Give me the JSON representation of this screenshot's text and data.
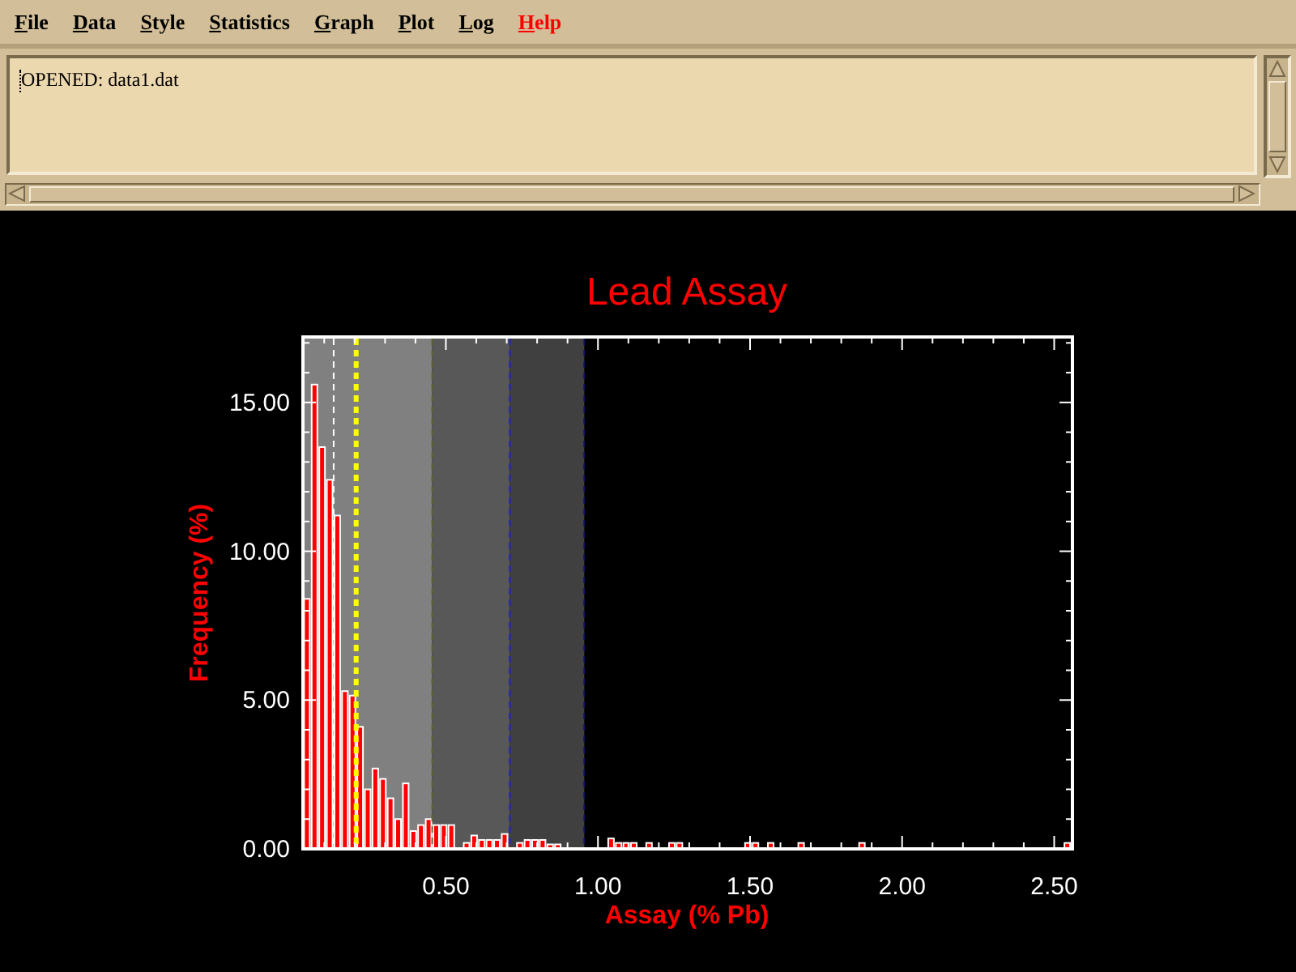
{
  "menu": [
    {
      "label": "File",
      "color": "#000000"
    },
    {
      "label": "Data",
      "color": "#000000"
    },
    {
      "label": "Style",
      "color": "#000000"
    },
    {
      "label": "Statistics",
      "color": "#000000"
    },
    {
      "label": "Graph",
      "color": "#000000"
    },
    {
      "label": "Plot",
      "color": "#000000"
    },
    {
      "label": "Log",
      "color": "#000000"
    },
    {
      "label": "Help",
      "color": "#ff0000"
    }
  ],
  "log": {
    "lines": [
      "OPENED: data1.dat"
    ]
  },
  "chart": {
    "chart_data": {
      "type": "bar",
      "title": "Lead Assay",
      "xlabel": "Assay (% Pb)",
      "ylabel": "Frequency (%)",
      "x": [
        0.043,
        0.068,
        0.093,
        0.118,
        0.143,
        0.168,
        0.193,
        0.218,
        0.243,
        0.268,
        0.293,
        0.318,
        0.343,
        0.368,
        0.393,
        0.418,
        0.443,
        0.468,
        0.493,
        0.518,
        0.568,
        0.593,
        0.618,
        0.643,
        0.668,
        0.693,
        0.743,
        0.768,
        0.793,
        0.818,
        0.843,
        0.868,
        1.043,
        1.068,
        1.093,
        1.118,
        1.168,
        1.243,
        1.268,
        1.493,
        1.518,
        1.568,
        1.668,
        1.868,
        2.543
      ],
      "series": [
        {
          "color": "#ff0000",
          "values": [
            8.4,
            15.6,
            13.5,
            12.4,
            11.2,
            5.3,
            5.15,
            4.1,
            2.0,
            2.7,
            2.35,
            1.7,
            1.0,
            2.2,
            0.6,
            0.8,
            1.0,
            0.8,
            0.8,
            0.8,
            0.2,
            0.45,
            0.3,
            0.3,
            0.3,
            0.5,
            0.2,
            0.3,
            0.3,
            0.3,
            0.15,
            0.15,
            0.35,
            0.2,
            0.2,
            0.2,
            0.2,
            0.2,
            0.2,
            0.2,
            0.2,
            0.2,
            0.2,
            0.2,
            0.2
          ]
        }
      ],
      "xlim": [
        0.03,
        2.56
      ],
      "ylim": [
        0,
        17.2
      ],
      "xticks": [
        {
          "value": 0.5,
          "label": "0.50"
        },
        {
          "value": 1.0,
          "label": "1.00"
        },
        {
          "value": 1.5,
          "label": "1.50"
        },
        {
          "value": 2.0,
          "label": "2.00"
        },
        {
          "value": 2.5,
          "label": "2.50"
        }
      ],
      "yticks": [
        {
          "value": 0,
          "label": "0.00"
        },
        {
          "value": 5,
          "label": "5.00"
        },
        {
          "value": 10,
          "label": "10.00"
        },
        {
          "value": 15,
          "label": "15.00"
        }
      ],
      "bands": [
        {
          "axis": "x",
          "from": 0.03,
          "to": 0.455,
          "color": "#808080"
        },
        {
          "axis": "x",
          "from": 0.455,
          "to": 0.71,
          "color": "#585858"
        },
        {
          "axis": "x",
          "from": 0.71,
          "to": 0.955,
          "color": "#404040"
        }
      ],
      "ref_lines": [
        {
          "axis": "x",
          "value": 0.131,
          "color": "#ffffff"
        },
        {
          "axis": "x",
          "value": 0.205,
          "color": "#ffff00"
        },
        {
          "axis": "x",
          "value": 0.455,
          "color": "#606030"
        },
        {
          "axis": "x",
          "value": 0.71,
          "color": "#2020c0"
        },
        {
          "axis": "x",
          "value": 0.955,
          "color": "#101060"
        }
      ]
    }
  }
}
